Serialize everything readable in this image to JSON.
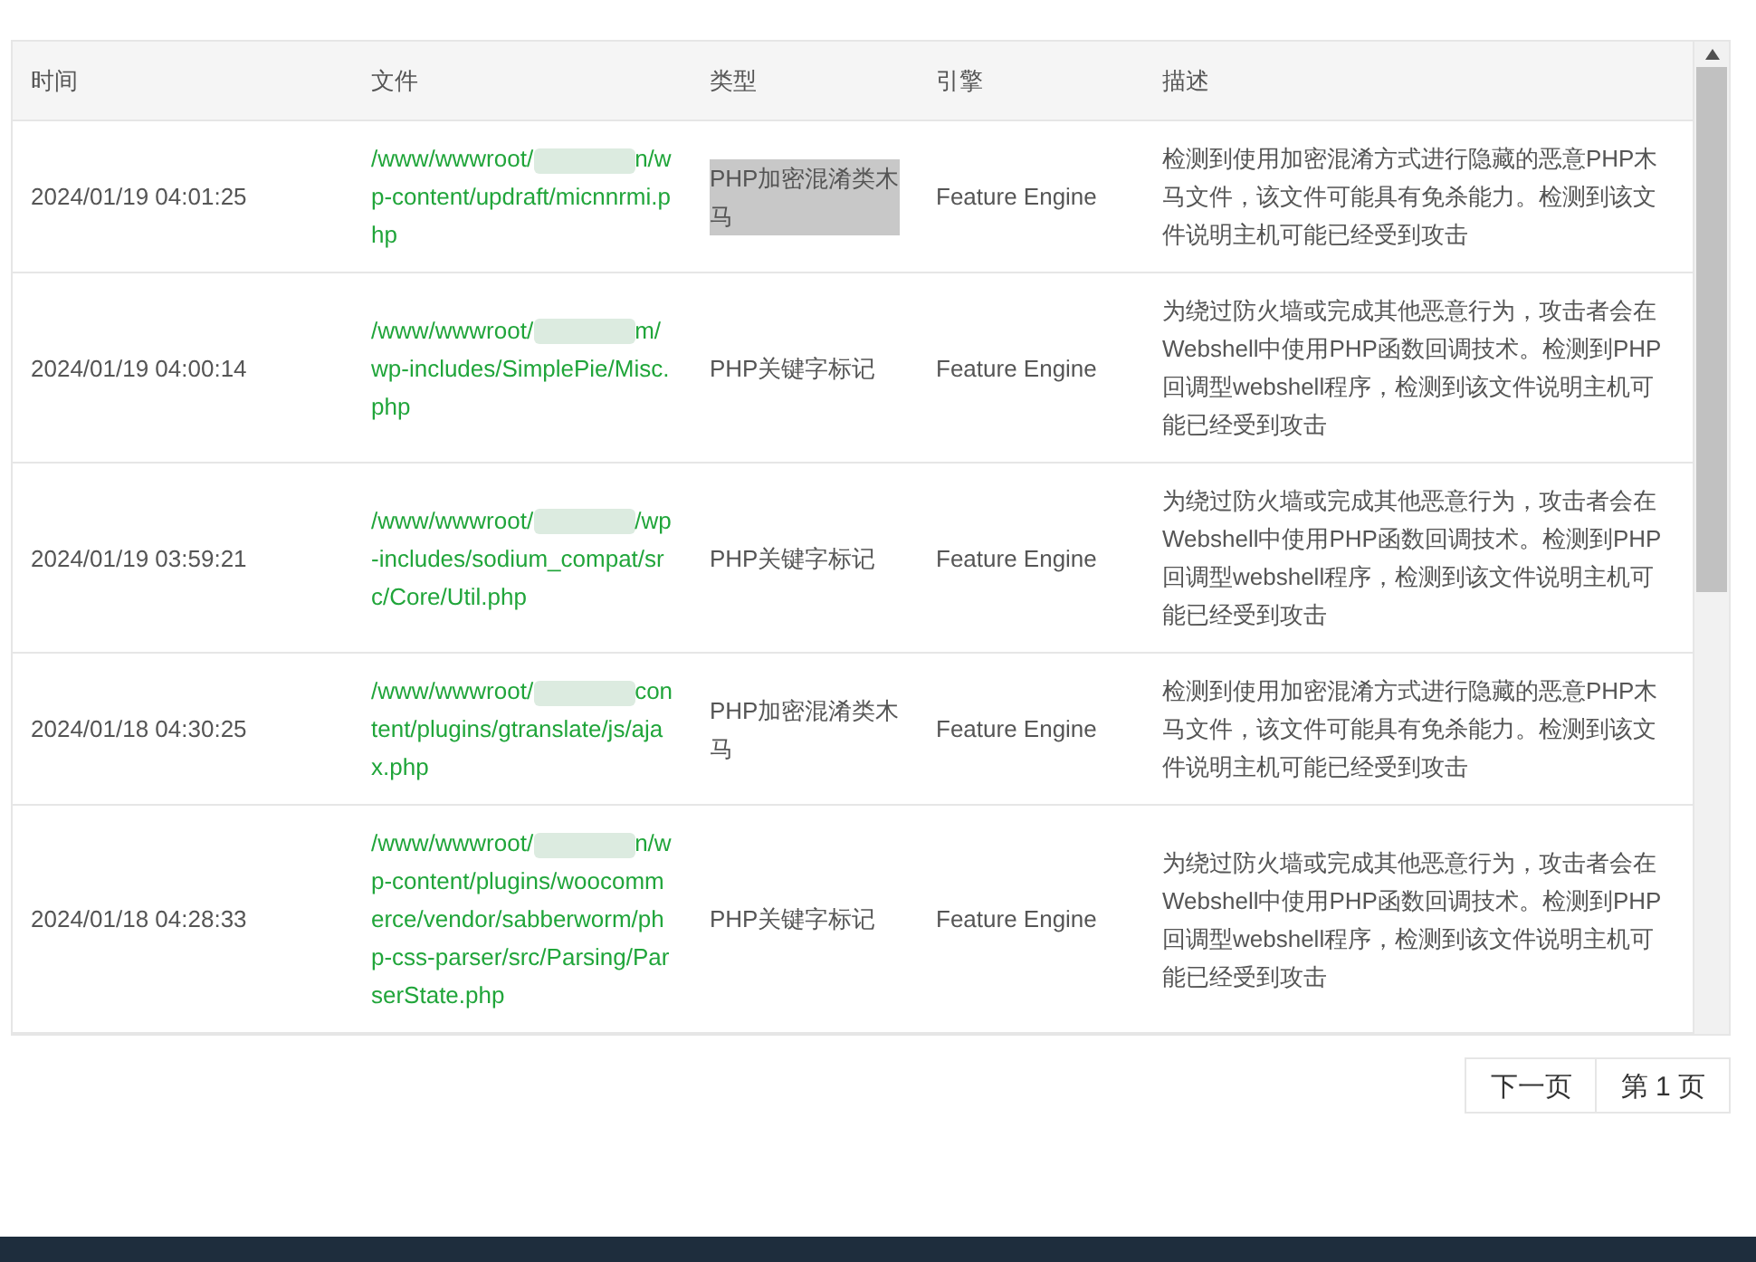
{
  "table": {
    "columns": [
      "时间",
      "文件",
      "类型",
      "引擎",
      "描述"
    ],
    "rows": [
      {
        "time": "2024/01/19 04:01:25",
        "file_start": "/www/wwwroot/",
        "file_end": "n/wp-content/updraft/micnnrmi.php",
        "type": "PHP加密混淆类木马",
        "type_highlighted": true,
        "engine": "Feature Engine",
        "description": "检测到使用加密混淆方式进行隐藏的恶意PHP木马文件，该文件可能具有免杀能力。检测到该文件说明主机可能已经受到攻击"
      },
      {
        "time": "2024/01/19 04:00:14",
        "file_start": "/www/wwwroot/",
        "file_end": "m/wp-includes/SimplePie/Misc.php",
        "type": "PHP关键字标记",
        "type_highlighted": false,
        "engine": "Feature Engine",
        "description": "为绕过防火墙或完成其他恶意行为，攻击者会在Webshell中使用PHP函数回调技术。检测到PHP回调型webshell程序，检测到该文件说明主机可能已经受到攻击"
      },
      {
        "time": "2024/01/19 03:59:21",
        "file_start": "/www/wwwroot/",
        "file_end": "/wp-includes/sodium_compat/src/Core/Util.php",
        "type": "PHP关键字标记",
        "type_highlighted": false,
        "engine": "Feature Engine",
        "description": "为绕过防火墙或完成其他恶意行为，攻击者会在Webshell中使用PHP函数回调技术。检测到PHP回调型webshell程序，检测到该文件说明主机可能已经受到攻击"
      },
      {
        "time": "2024/01/18 04:30:25",
        "file_start": "/www/wwwroot/",
        "file_end": "content/plugins/gtranslate/js/ajax.php",
        "type": "PHP加密混淆类木马",
        "type_highlighted": false,
        "engine": "Feature Engine",
        "description": "检测到使用加密混淆方式进行隐藏的恶意PHP木马文件，该文件可能具有免杀能力。检测到该文件说明主机可能已经受到攻击"
      },
      {
        "time": "2024/01/18 04:28:33",
        "file_start": "/www/wwwroot/",
        "file_end": "n/wp-content/plugins/woocommerce/vendor/sabberworm/php-css-parser/src/Parsing/ParserState.php",
        "type": "PHP关键字标记",
        "type_highlighted": false,
        "engine": "Feature Engine",
        "description": "为绕过防火墙或完成其他恶意行为，攻击者会在Webshell中使用PHP函数回调技术。检测到PHP回调型webshell程序，检测到该文件说明主机可能已经受到攻击"
      }
    ]
  },
  "pagination": [
    "下一页",
    "第 1 页"
  ]
}
